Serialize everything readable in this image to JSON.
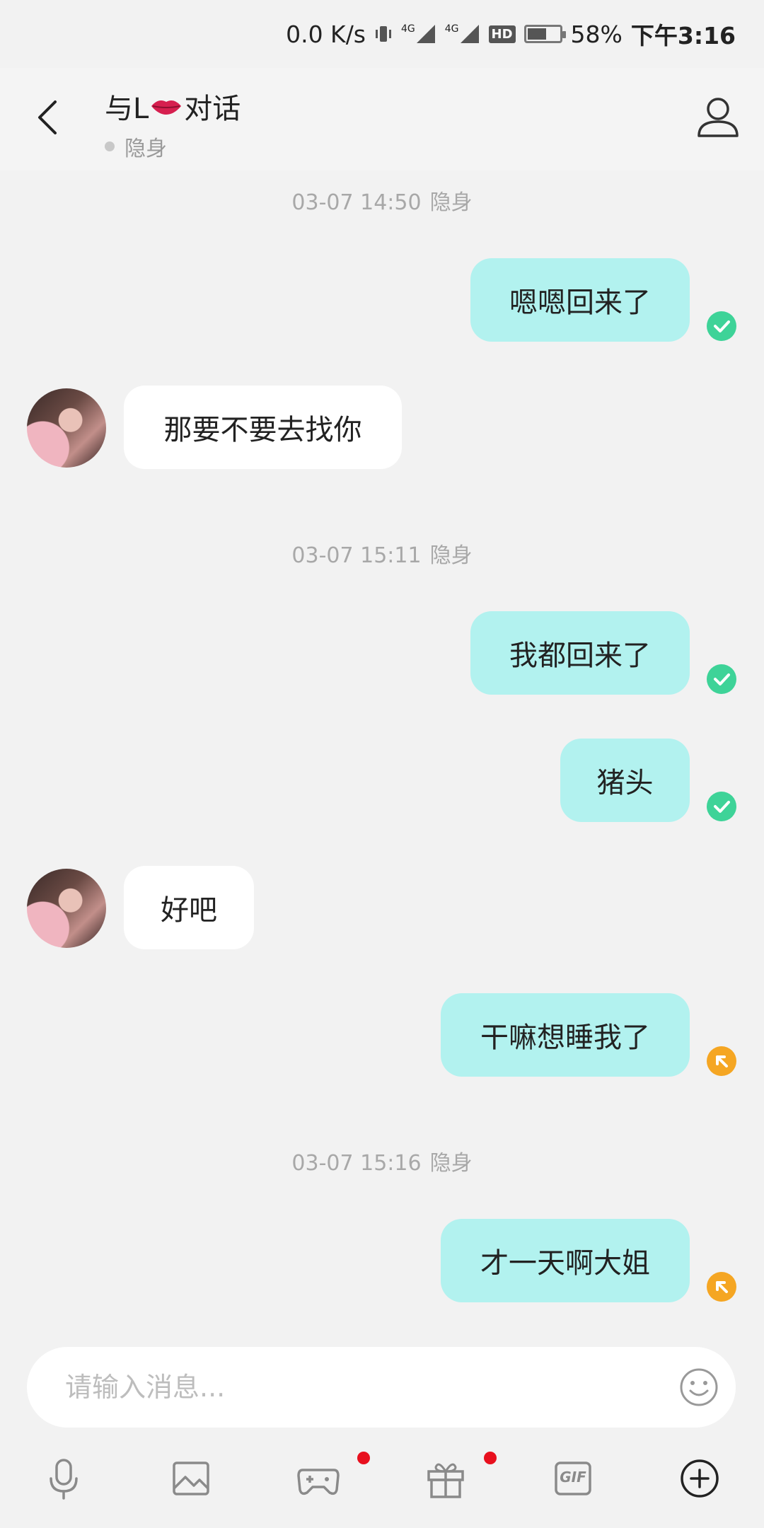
{
  "status_bar": {
    "net_speed": "0.0 K/s",
    "net1": "4G",
    "net2": "4G",
    "hd": "HD",
    "battery_percent_text": "58%",
    "battery_level": 0.58,
    "time": "下午3:16"
  },
  "header": {
    "title_prefix": "与L",
    "title_emoji": "lips-icon",
    "title_suffix": "对话",
    "status": "隐身"
  },
  "messages": [
    {
      "type": "timestamp",
      "time": "03-07 14:50",
      "status": "隐身"
    },
    {
      "type": "out",
      "text": "嗯嗯回来了",
      "state": "sent"
    },
    {
      "type": "in",
      "text": "那要不要去找你"
    },
    {
      "type": "timestamp",
      "time": "03-07 15:11",
      "status": "隐身"
    },
    {
      "type": "out",
      "text": "我都回来了",
      "state": "sent"
    },
    {
      "type": "out",
      "text": "猪头",
      "state": "sent"
    },
    {
      "type": "in",
      "text": "好吧"
    },
    {
      "type": "out",
      "text": "干嘛想睡我了",
      "state": "pending"
    },
    {
      "type": "timestamp",
      "time": "03-07 15:16",
      "status": "隐身"
    },
    {
      "type": "out",
      "text": "才一天啊大姐",
      "state": "pending"
    }
  ],
  "input": {
    "placeholder": "请输入消息...",
    "value": ""
  },
  "toolbar": {
    "items": [
      {
        "icon": "microphone-icon",
        "badge": false
      },
      {
        "icon": "image-icon",
        "badge": false
      },
      {
        "icon": "gamepad-icon",
        "badge": true
      },
      {
        "icon": "gift-icon",
        "badge": true
      },
      {
        "icon": "gif-icon",
        "label": "GIF",
        "badge": false
      },
      {
        "icon": "plus-circle-icon",
        "badge": false
      }
    ]
  },
  "colors": {
    "out_bubble": "#b2f2ef",
    "in_bubble": "#ffffff",
    "sent_mark": "#3ed398",
    "pending_mark": "#f5a623",
    "badge": "#e8101e"
  }
}
